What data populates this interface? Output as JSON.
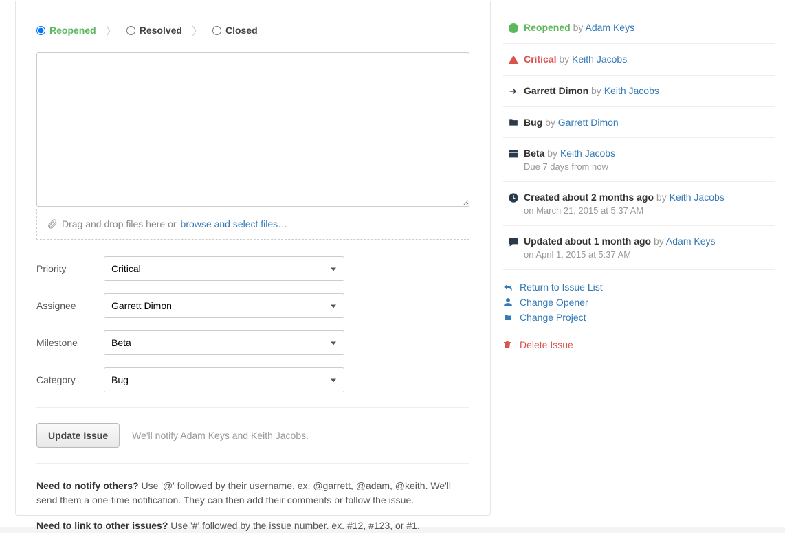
{
  "status_tabs": {
    "reopened": "Reopened",
    "resolved": "Resolved",
    "closed": "Closed"
  },
  "dropzone": {
    "prefix": "Drag and drop files here or ",
    "link": "browse and select files…"
  },
  "form": {
    "priority_label": "Priority",
    "priority_value": "Critical",
    "assignee_label": "Assignee",
    "assignee_value": "Garrett Dimon",
    "milestone_label": "Milestone",
    "milestone_value": "Beta",
    "category_label": "Category",
    "category_value": "Bug"
  },
  "submit": {
    "button": "Update Issue",
    "notify": "We'll notify Adam Keys and Keith Jacobs."
  },
  "help": {
    "notify_title": "Need to notify others?",
    "notify_body": " Use '@' followed by their username. ex. @garrett, @adam, @keith. We'll send them a one-time notification. They can then add their comments or follow the issue.",
    "link_title": "Need to link to other issues?",
    "link_body": " Use '#' followed by the issue number. ex. #12, #123, or #1."
  },
  "sidebar": {
    "status": {
      "label": "Reopened",
      "by_prefix": "by ",
      "by": "Adam Keys"
    },
    "priority": {
      "label": "Critical",
      "by_prefix": "by ",
      "by": "Keith Jacobs"
    },
    "assignee": {
      "label": "Garrett Dimon",
      "by_prefix": "by ",
      "by": "Keith Jacobs"
    },
    "category": {
      "label": "Bug",
      "by_prefix": "by ",
      "by": "Garrett Dimon"
    },
    "milestone": {
      "label": "Beta",
      "by_prefix": "by ",
      "by": "Keith Jacobs",
      "due": "Due 7 days from now"
    },
    "created": {
      "label": "Created about 2 months ago",
      "by_prefix": "by ",
      "by": "Keith Jacobs",
      "date": "on March 21, 2015 at 5:37 AM"
    },
    "updated": {
      "label": "Updated about 1 month ago",
      "by_prefix": "by ",
      "by": "Adam Keys",
      "date": "on April 1, 2015 at 5:37 AM"
    },
    "links": {
      "return": "Return to Issue List",
      "opener": "Change Opener",
      "project": "Change Project",
      "delete": "Delete Issue"
    }
  }
}
